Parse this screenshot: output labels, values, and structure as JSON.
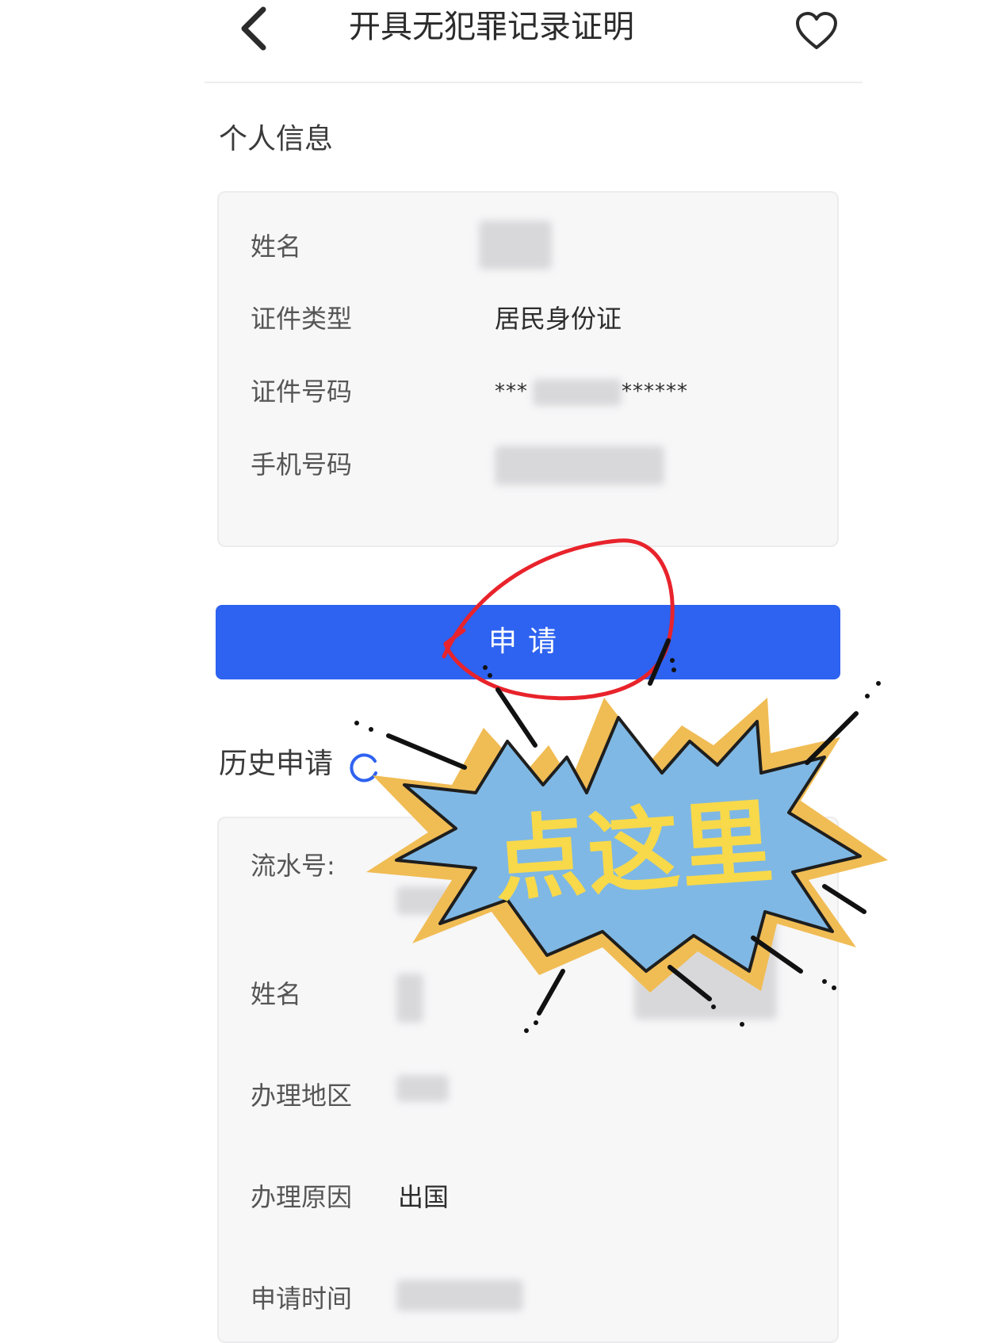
{
  "header": {
    "title": "开具无犯罪记录证明",
    "back_icon": "chevron-left-icon",
    "favorite_icon": "heart-outline-icon"
  },
  "personal_info": {
    "section_title": "个人信息",
    "fields": [
      {
        "label": "姓名",
        "value": ""
      },
      {
        "label": "证件类型",
        "value": "居民身份证"
      },
      {
        "label": "证件号码",
        "value_prefix": "***",
        "value_suffix": "******"
      },
      {
        "label": "手机号码",
        "value": ""
      }
    ]
  },
  "apply_button": {
    "label": "申请"
  },
  "history": {
    "section_title": "历史申请",
    "refresh_icon": "refresh-icon",
    "fields": [
      {
        "label": "流水号:",
        "value": ""
      },
      {
        "label": "姓名",
        "value": ""
      },
      {
        "label": "办理地区",
        "value": ""
      },
      {
        "label": "办理原因",
        "value": "出国"
      },
      {
        "label": "申请时间",
        "value": ""
      }
    ]
  },
  "annotation": {
    "callout_text": "点这里",
    "burst_fill": "#7fb8e4",
    "burst_outline": "#f0bc54",
    "circle_stroke": "#e8232b",
    "text_color": "#f8d94a"
  },
  "colors": {
    "primary_button": "#2e62f0",
    "refresh_icon": "#2e62f0"
  }
}
